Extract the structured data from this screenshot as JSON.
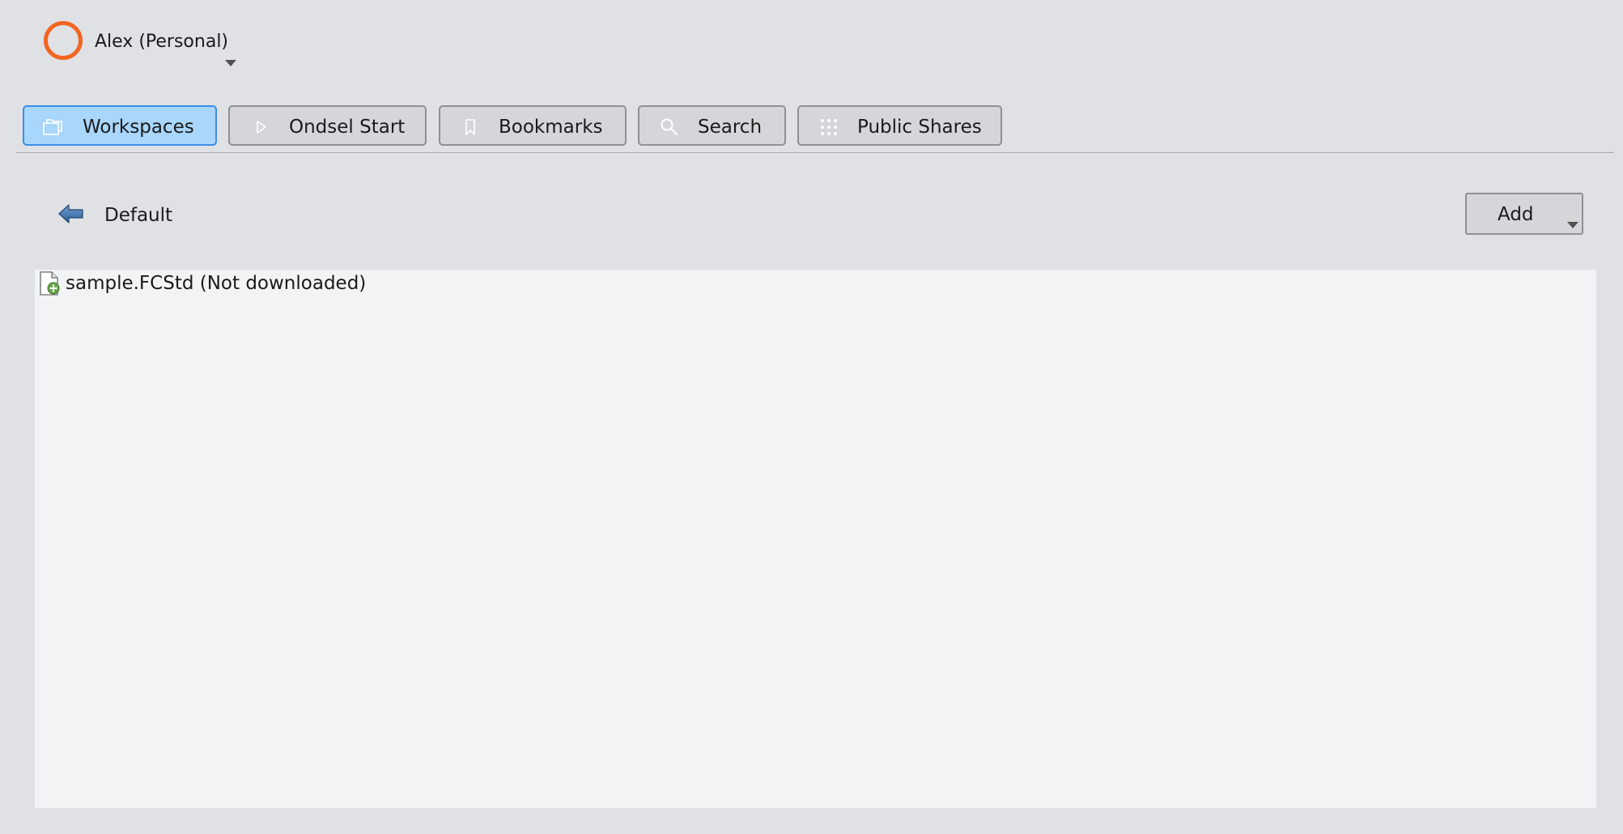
{
  "account": {
    "name": "Alex (Personal)",
    "avatar_color": "#f26522"
  },
  "tabs": [
    {
      "label": "Workspaces",
      "icon": "folders-icon",
      "active": true
    },
    {
      "label": "Ondsel Start",
      "icon": "play-icon",
      "active": false
    },
    {
      "label": "Bookmarks",
      "icon": "bookmark-icon",
      "active": false
    },
    {
      "label": "Search",
      "icon": "search-icon",
      "active": false
    },
    {
      "label": "Public Shares",
      "icon": "grid-icon",
      "active": false
    }
  ],
  "navigation": {
    "back_icon": "back-arrow-icon",
    "current_folder": "Default"
  },
  "toolbar": {
    "add_label": "Add"
  },
  "files": [
    {
      "name": "sample.FCStd (Not downloaded)",
      "icon": "file-add-icon"
    }
  ],
  "colors": {
    "active_tab_bg": "#a9d6fb",
    "active_tab_border": "#3b8ee6",
    "window_bg": "#dfe1e5",
    "list_bg": "#f2f3f4"
  }
}
